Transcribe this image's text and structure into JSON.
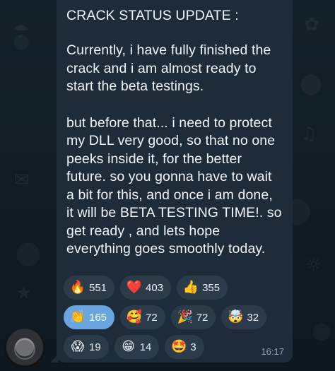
{
  "message": {
    "title": "CRACK STATUS UPDATE :",
    "paragraphs": [
      "Currently, i have fully finished the crack and i am almost ready to start the beta testings.",
      "but before that... i need to protect my DLL very good, so that no one peeks inside it, for the better future. so you gonna have to wait a bit for this, and once i am done, it will be BETA TESTING TIME!. so get ready , and lets hope everything goes smoothly today."
    ],
    "time": "16:17"
  },
  "reactions": {
    "row1": [
      {
        "emoji": "🔥",
        "emoji_name": "fire-icon",
        "count": "551",
        "chosen": false
      },
      {
        "emoji": "❤️",
        "emoji_name": "heart-icon",
        "count": "403",
        "chosen": false
      },
      {
        "emoji": "👍",
        "emoji_name": "thumbs-up-icon",
        "count": "355",
        "chosen": false
      }
    ],
    "row2": [
      {
        "emoji": "👏",
        "emoji_name": "clapping-hands-icon",
        "count": "165",
        "chosen": true
      },
      {
        "emoji": "🥰",
        "emoji_name": "smiling-face-hearts-icon",
        "count": "72",
        "chosen": false
      },
      {
        "emoji": "🎉",
        "emoji_name": "party-popper-icon",
        "count": "72",
        "chosen": false
      },
      {
        "emoji": "🤯",
        "emoji_name": "exploding-head-icon",
        "count": "32",
        "chosen": false
      }
    ],
    "row3": [
      {
        "emoji": "😱",
        "emoji_name": "screaming-face-icon",
        "count": "19",
        "chosen": false
      },
      {
        "emoji": "😁",
        "emoji_name": "grinning-face-icon",
        "count": "14",
        "chosen": false
      },
      {
        "emoji": "🤩",
        "emoji_name": "star-struck-icon",
        "count": "3",
        "chosen": false
      }
    ]
  },
  "colors": {
    "background": "#0f1a22",
    "bubble": "#1e2c3a",
    "reaction_pill": "#2c3b4a",
    "reaction_chosen": "#69a6e0",
    "text": "#f2f5f8",
    "time_text": "#8da1b3"
  }
}
